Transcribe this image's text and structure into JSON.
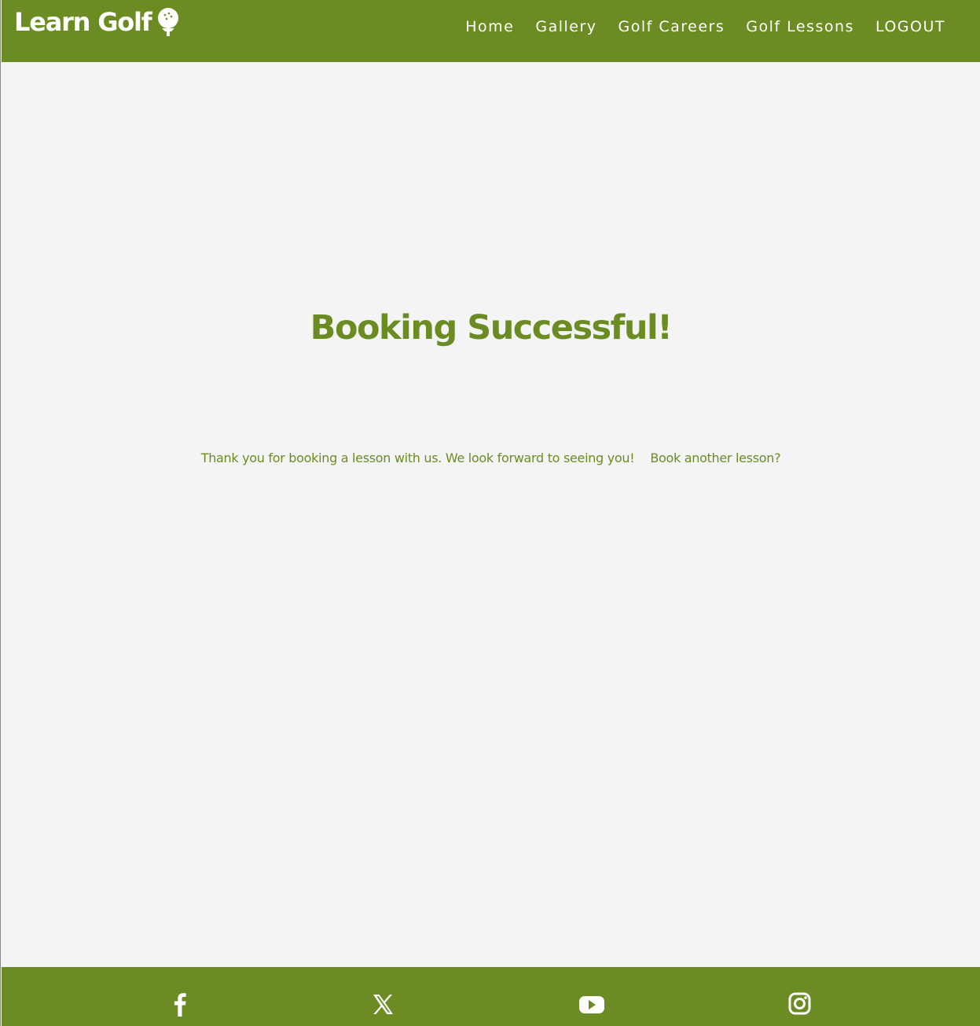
{
  "header": {
    "brand": "Learn Golf",
    "brand_icon": "golf-ball-on-tee-icon",
    "nav": [
      {
        "label": "Home"
      },
      {
        "label": "Gallery"
      },
      {
        "label": "Golf Careers"
      },
      {
        "label": "Golf Lessons"
      },
      {
        "label": "LOGOUT"
      }
    ]
  },
  "main": {
    "title": "Booking Successful!",
    "message": "Thank you for booking a lesson with us. We look forward to seeing you!",
    "link": "Book another lesson?"
  },
  "footer": {
    "social_icons": [
      "facebook-icon",
      "x-twitter-icon",
      "youtube-icon",
      "instagram-icon"
    ]
  },
  "colors": {
    "brand_green": "#6b8c23",
    "background": "#f4f4f4",
    "text_on_brand": "#ffffff"
  }
}
